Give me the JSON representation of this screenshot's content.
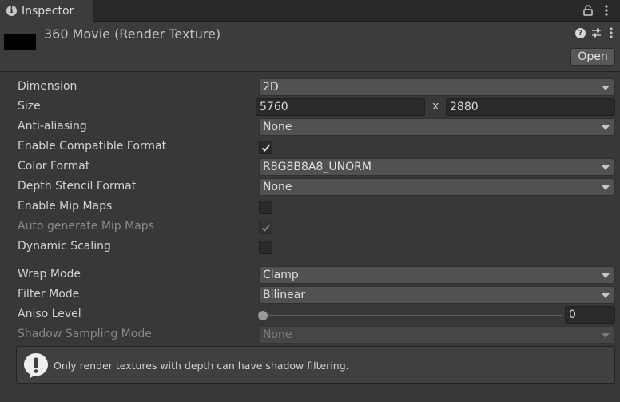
{
  "tab": {
    "icon": "info-icon",
    "label": "Inspector"
  },
  "header": {
    "title": "360 Movie (Render Texture)",
    "open_button": "Open"
  },
  "properties": {
    "dimension": {
      "label": "Dimension",
      "value": "2D"
    },
    "size": {
      "label": "Size",
      "width": "5760",
      "separator": "x",
      "height": "2880"
    },
    "anti_aliasing": {
      "label": "Anti-aliasing",
      "value": "None"
    },
    "enable_compatible_format": {
      "label": "Enable Compatible Format",
      "checked": true
    },
    "color_format": {
      "label": "Color Format",
      "value": "R8G8B8A8_UNORM"
    },
    "depth_stencil_format": {
      "label": "Depth Stencil Format",
      "value": "None"
    },
    "enable_mip_maps": {
      "label": "Enable Mip Maps",
      "checked": false
    },
    "auto_generate_mip_maps": {
      "label": "Auto generate Mip Maps",
      "checked": true,
      "disabled": true
    },
    "dynamic_scaling": {
      "label": "Dynamic Scaling",
      "checked": false
    },
    "wrap_mode": {
      "label": "Wrap Mode",
      "value": "Clamp"
    },
    "filter_mode": {
      "label": "Filter Mode",
      "value": "Bilinear"
    },
    "aniso_level": {
      "label": "Aniso Level",
      "value": "0"
    },
    "shadow_sampling_mode": {
      "label": "Shadow Sampling Mode",
      "value": "None",
      "disabled": true
    }
  },
  "help_box": {
    "icon": "warning-icon",
    "message": "Only render textures with depth can have shadow filtering."
  },
  "colors": {
    "panel_bg": "#383838",
    "header_bg": "#3c3c3c",
    "tab_bar_bg": "#282828",
    "dropdown_bg": "#515151",
    "field_bg": "#2a2a2a",
    "text": "#d2d2d2",
    "disabled_text": "#8a8a8a"
  }
}
